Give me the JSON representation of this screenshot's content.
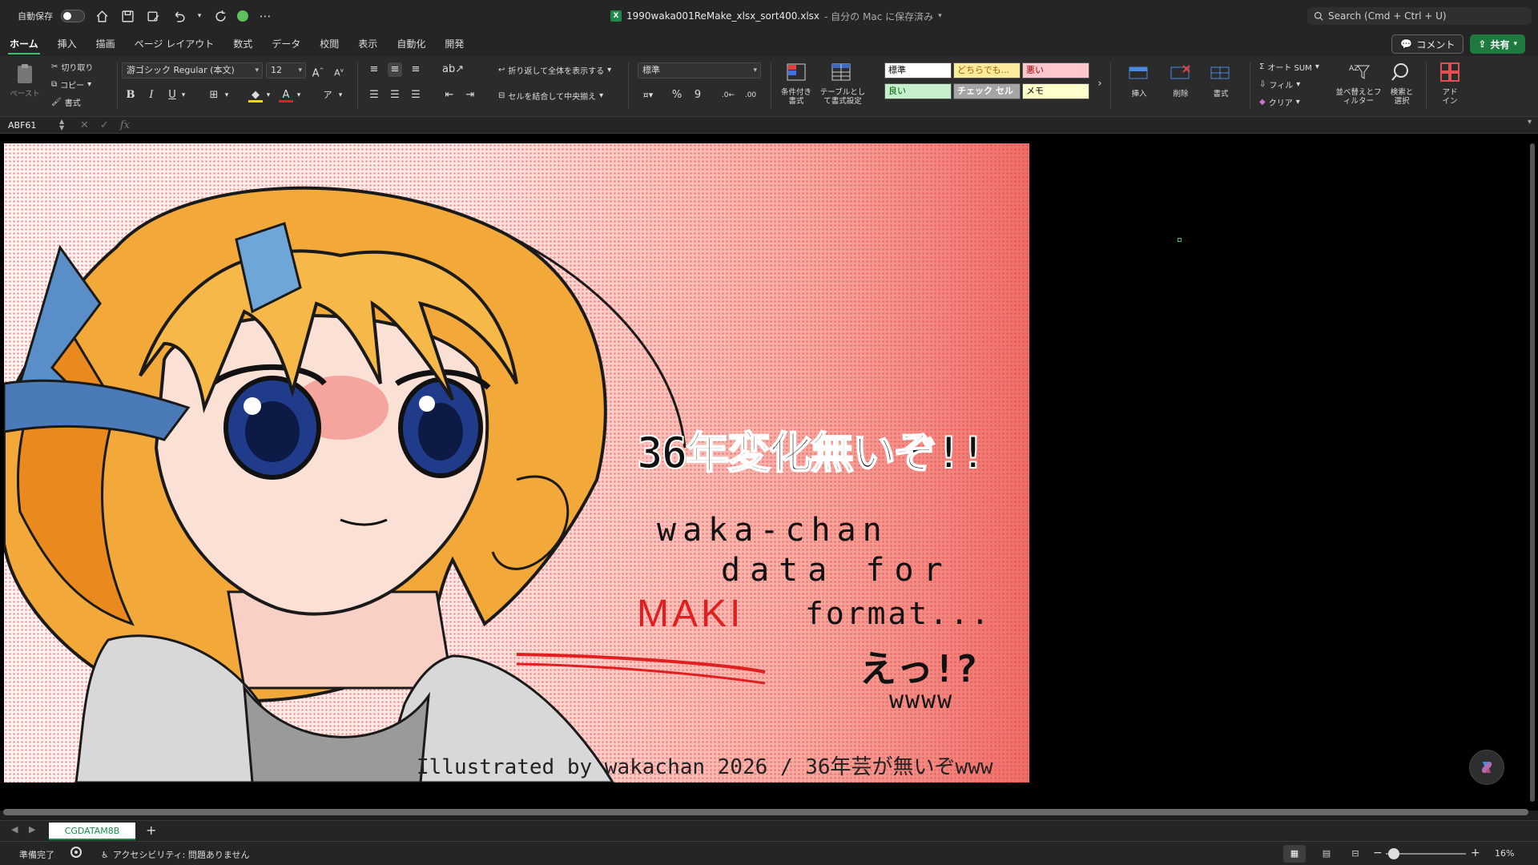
{
  "titlebar": {
    "autosave_label": "自動保存",
    "filename": "1990waka001ReMake_xlsx_sort400.xlsx",
    "save_location": "- 自分の Mac に保存済み",
    "search_placeholder": "Search (Cmd + Ctrl + U)"
  },
  "tabs": [
    {
      "label": "ホーム"
    },
    {
      "label": "挿入"
    },
    {
      "label": "描画"
    },
    {
      "label": "ページ レイアウト"
    },
    {
      "label": "数式"
    },
    {
      "label": "データ"
    },
    {
      "label": "校閲"
    },
    {
      "label": "表示"
    },
    {
      "label": "自動化"
    },
    {
      "label": "開発"
    }
  ],
  "actions": {
    "comment": "コメント",
    "share": "共有"
  },
  "ribbon": {
    "paste": "ペースト",
    "cut": "切り取り",
    "copy": "コピー",
    "format_painter": "書式",
    "font_name": "游ゴシック Regular (本文)",
    "font_size": "12",
    "bold": "B",
    "italic": "I",
    "underline": "U",
    "wrap_text": "折り返して全体を表示する",
    "merge_center": "セルを結合して中央揃え",
    "number_format": "標準",
    "percent": "%",
    "conditional_format": "条件付き書式",
    "format_as_table": "テーブルとして書式設定",
    "styles": [
      {
        "label": "標準",
        "bg": "#ffffff",
        "fg": "#000000"
      },
      {
        "label": "どちらでも...",
        "bg": "#ffeb9c",
        "fg": "#9c6500"
      },
      {
        "label": "悪い",
        "bg": "#ffc7ce",
        "fg": "#9c0006"
      },
      {
        "label": "良い",
        "bg": "#c6efce",
        "fg": "#006100"
      },
      {
        "label": "チェック セル",
        "bg": "#a5a5a5",
        "fg": "#ffffff"
      },
      {
        "label": "メモ",
        "bg": "#ffffcc",
        "fg": "#000000"
      }
    ],
    "insert": "挿入",
    "delete": "削除",
    "format": "書式",
    "autosum": "オート SUM",
    "fill": "フィル",
    "clear": "クリア",
    "sort_filter": "並べ替えとフィルター",
    "find_select": "検索と選択",
    "addin": "アドイン"
  },
  "formula_bar": {
    "name_box": "ABF61",
    "fx": "fx"
  },
  "artwork": {
    "headline": "36年変化無いぞ!!",
    "line1": "waka-chan",
    "line2": "data  for",
    "maki": "MAKI",
    "line3": "format...",
    "exclaim": "えっ!?",
    "laugh": "wwww",
    "credit": "Illustrated by wakachan 2026 / 36年芸が無いぞwww"
  },
  "sheet_tabs": {
    "active": "CGDATAM8B"
  },
  "statusbar": {
    "ready": "準備完了",
    "accessibility": "アクセシビリティ: 問題ありません",
    "zoom": "16%"
  }
}
